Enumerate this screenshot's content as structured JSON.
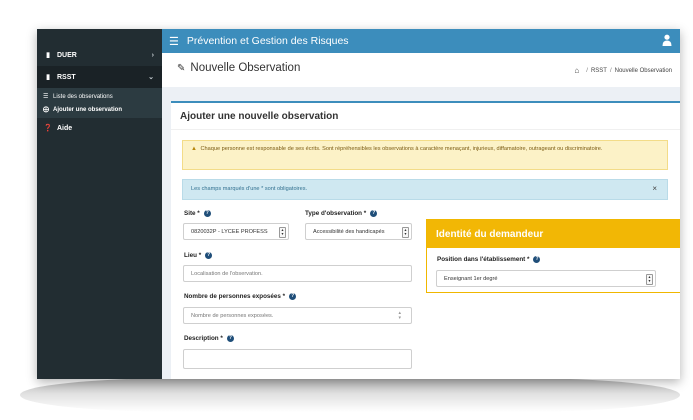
{
  "sidebar": {
    "items": [
      {
        "label": "DUER",
        "icon": "file-icon"
      },
      {
        "label": "RSST",
        "icon": "book-icon"
      },
      {
        "label": "Aide",
        "icon": "question-circle-icon"
      }
    ],
    "subitems": [
      {
        "label": "Liste des observations",
        "icon": "list-icon"
      },
      {
        "label": "Ajouter une observation",
        "icon": "plus-circle-icon"
      }
    ]
  },
  "topbar": {
    "title": "Prévention et Gestion des Risques",
    "color": "#3c8dbc"
  },
  "page": {
    "title": "Nouvelle Observation",
    "breadcrumb": [
      "RSST",
      "Nouvelle Observation"
    ]
  },
  "card": {
    "title": "Ajouter une nouvelle observation",
    "warning": "Chaque personne est responsable de ses écrits. Sont répréhensibles les observations à caractère menaçant, injurieux, diffamatoire, outrageant ou discriminatoire.",
    "info": "Les champs marqués d'une * sont obligatoires.",
    "close_symbol": "×"
  },
  "form": {
    "site": {
      "label": "Site *",
      "value": "0820032P - LYCEE PROFESS"
    },
    "type_observation": {
      "label": "Type d'observation *",
      "value": "Accessibilité des handicapés"
    },
    "lieu": {
      "label": "Lieu *",
      "placeholder": "Localisation de l'observation."
    },
    "nb_personnes": {
      "label": "Nombre de personnes exposées *",
      "placeholder": "Nombre de personnes exposées."
    },
    "description": {
      "label": "Description *"
    }
  },
  "identite": {
    "title": "Identité du demandeur",
    "position_label": "Position dans l'établissement *",
    "position_value": "Enseignant 1er degré",
    "accent": "#f2b705"
  }
}
